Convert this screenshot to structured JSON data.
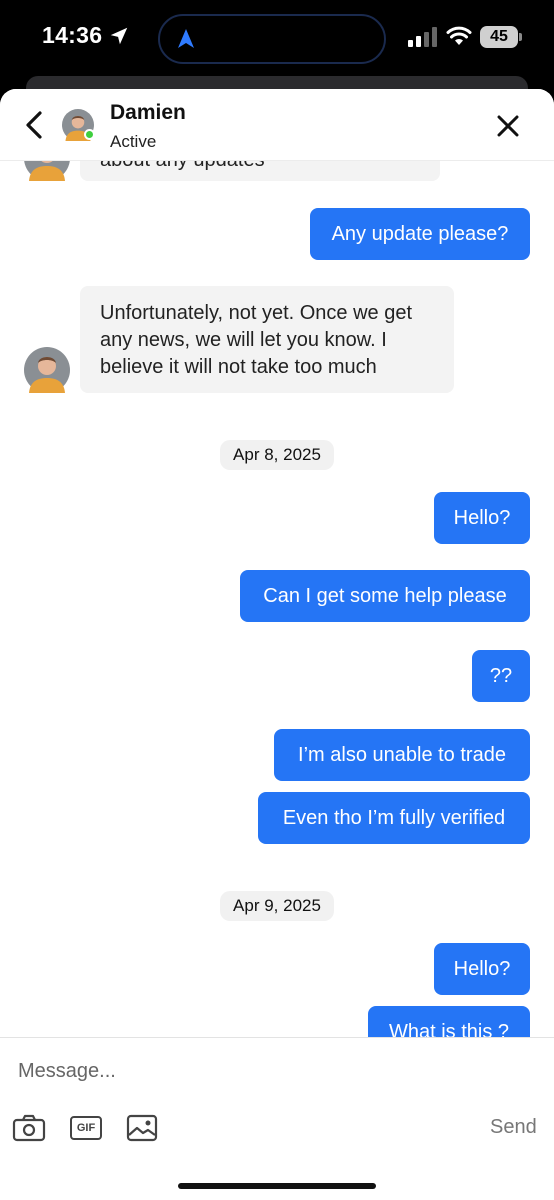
{
  "status_bar": {
    "time": "14:36",
    "battery": "45",
    "icons": [
      "location-arrow-icon",
      "dynamic-island-navigation-icon",
      "cellular-signal-icon",
      "wifi-icon",
      "battery-icon"
    ]
  },
  "header": {
    "contact_name": "Damien",
    "status": "Active",
    "icons": [
      "chevron-left-icon",
      "avatar",
      "close-icon"
    ]
  },
  "messages": [
    {
      "direction": "in",
      "text": "about any updates"
    },
    {
      "direction": "out",
      "text": "Any update please?"
    },
    {
      "direction": "in",
      "text": "Unfortunately, not yet. Once we get any news, we will let you know. I believe it will not take too much"
    },
    {
      "type": "date",
      "text": "Apr 8, 2025"
    },
    {
      "direction": "out",
      "text": "Hello?"
    },
    {
      "direction": "out",
      "text": "Can I get some help please"
    },
    {
      "direction": "out",
      "text": "??"
    },
    {
      "direction": "out",
      "text": "I’m also unable to trade"
    },
    {
      "direction": "out",
      "text": "Even tho I’m fully verified"
    },
    {
      "type": "date",
      "text": "Apr 9, 2025"
    },
    {
      "direction": "out",
      "text": "Hello?"
    },
    {
      "direction": "out",
      "text": "What is this ?"
    }
  ],
  "composer": {
    "placeholder": "Message...",
    "value": "",
    "gif_label": "GIF",
    "send_label": "Send",
    "icons": [
      "camera-icon",
      "gif-icon",
      "image-icon"
    ]
  },
  "colors": {
    "outgoing_bubble": "#2575f5",
    "incoming_bubble": "#f3f3f3",
    "online": "#3fcf3f"
  }
}
